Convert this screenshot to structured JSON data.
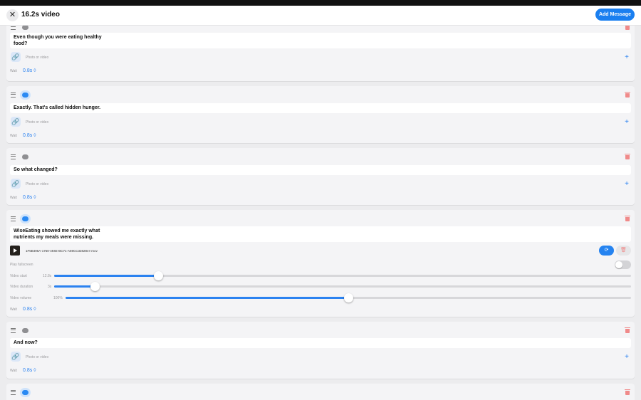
{
  "header": {
    "close_glyph": "✕",
    "title": "16.2s video",
    "add_button": "Add Message"
  },
  "common": {
    "photo_label": "Photo or video",
    "wait_label": "Wait",
    "attach_glyph": "🔗",
    "plus_glyph": "+"
  },
  "messages": [
    {
      "text_lines": [
        "Even though you were eating healthy",
        "food?"
      ],
      "wait": "0.8s ◊",
      "avatar": "gray"
    },
    {
      "text_lines": [
        "Exactly. That's called hidden hunger."
      ],
      "wait": "0.8s ◊",
      "avatar": "blue"
    },
    {
      "text_lines": [
        "So what changed?"
      ],
      "wait": "0.8s ◊",
      "avatar": "gray"
    },
    {
      "text_lines": [
        "WiseEating showed me exactly what",
        "nutrients my meals were missing."
      ],
      "wait": "0.8s ◊",
      "avatar": "blue"
    },
    {
      "text_lines": [
        "And now?"
      ],
      "wait": "0.8s ◊",
      "avatar": "gray"
    },
    {
      "text_lines": [],
      "wait": "",
      "avatar": "blue"
    }
  ],
  "video": {
    "filename": "1F5B496A-1750-494E-BC71-A59CC3282847.mov",
    "play_fullscreen_label": "Play fullscreen",
    "play_fullscreen": false,
    "start_label": "Video start",
    "start_value": "12.8s",
    "start_fraction": 0.18,
    "duration_label": "Video duration",
    "duration_value": "3s",
    "duration_fraction": 0.07,
    "volume_label": "Video volume",
    "volume_value": "100%",
    "volume_fraction": 0.5,
    "replace_glyph": "⟳",
    "delete_glyph": "🗑"
  },
  "colors": {
    "accent": "#1a7ff0",
    "danger": "#f08a8a"
  }
}
